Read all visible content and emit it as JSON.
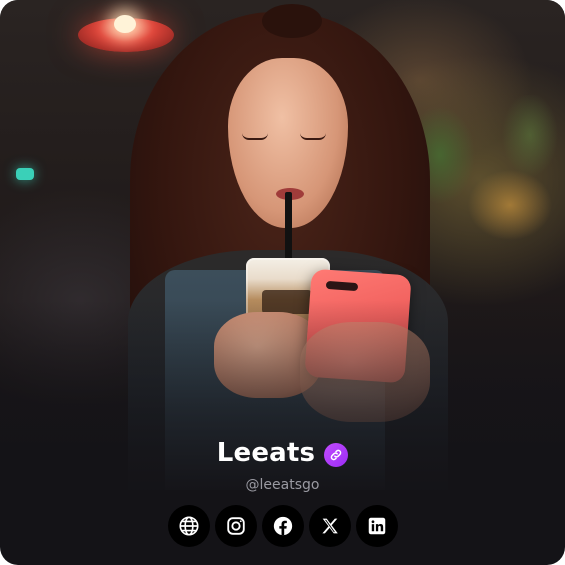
{
  "profile": {
    "name": "Leeats",
    "handle": "@leeatsgo",
    "badge_icon": "link-icon",
    "badge_color": "#a936f7"
  },
  "socials": [
    {
      "icon": "globe-icon",
      "label": "Website"
    },
    {
      "icon": "instagram-icon",
      "label": "Instagram"
    },
    {
      "icon": "facebook-icon",
      "label": "Facebook"
    },
    {
      "icon": "x-icon",
      "label": "X"
    },
    {
      "icon": "linkedin-icon",
      "label": "LinkedIn"
    }
  ],
  "colors": {
    "background": "#141317",
    "button": "#000000",
    "name": "#ffffff",
    "handle": "#9a9aa2"
  }
}
